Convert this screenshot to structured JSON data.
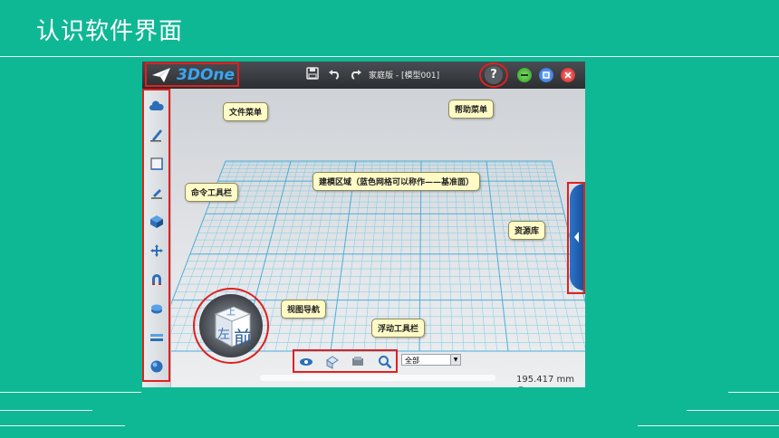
{
  "slide": {
    "title": "认识软件界面"
  },
  "app": {
    "logo": "3DOne",
    "document_title": "家庭版 - [模型001]",
    "help_label": "?",
    "view_cube": {
      "top_face": "上",
      "left_face": "左",
      "front_face": "前"
    },
    "filter_select": {
      "value": "全部"
    },
    "zoom_readout": "195.417 mm",
    "toolbar_tools": [
      "cloud-icon",
      "sketch-pen-icon",
      "sketch-plane-icon",
      "edit-sketch-icon",
      "solid-cube-icon",
      "move-arrows-icon",
      "magnet-icon",
      "combine-icon",
      "layer-icon",
      "sphere-icon"
    ]
  },
  "callouts": {
    "file_menu": "文件菜单",
    "help_menu": "帮助菜单",
    "command_toolbar": "命令工具栏",
    "modeling_area": "建模区域（蓝色网格可以称作——基准面）",
    "resource_library": "资源库",
    "view_navigation": "视图导航",
    "floating_toolbar": "浮动工具栏"
  },
  "colors": {
    "background": "#0fb895",
    "highlight": "#e02020",
    "callout": "#fffbc7",
    "grid": "#5cc4e6"
  }
}
